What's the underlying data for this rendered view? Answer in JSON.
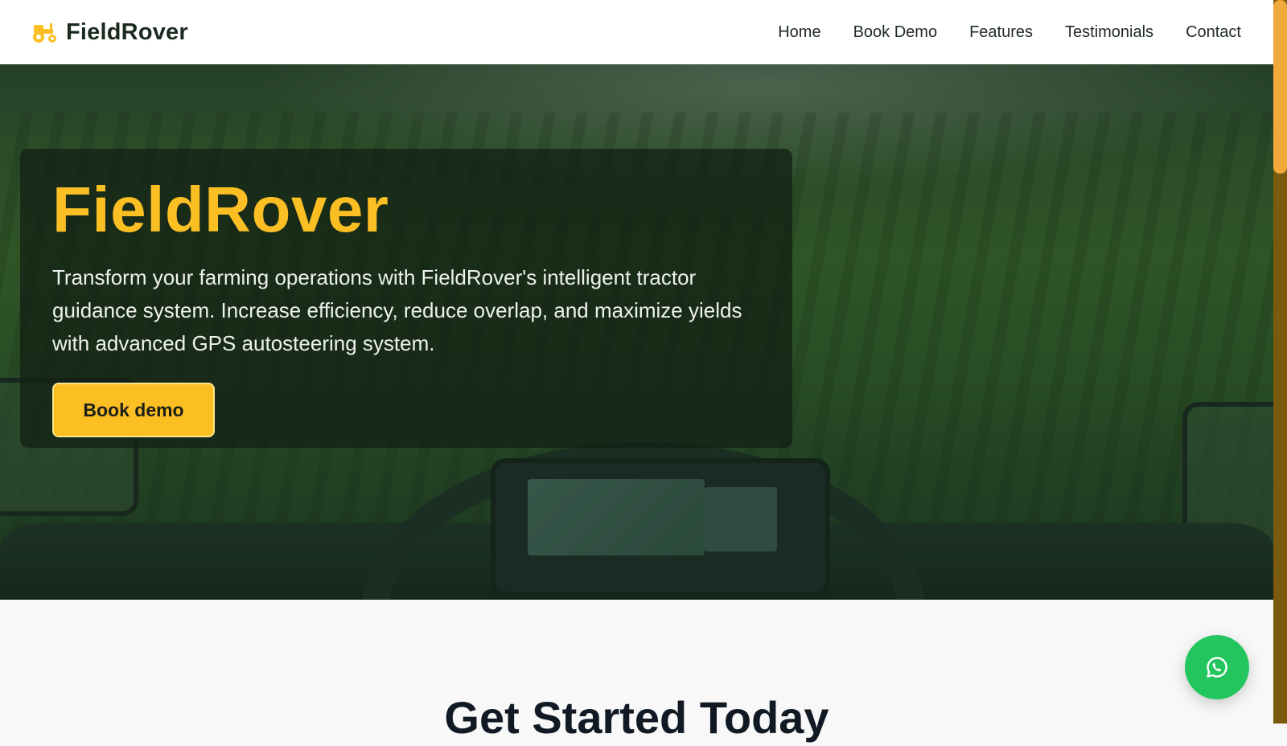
{
  "brand": {
    "name": "FieldRover",
    "icon": "tractor-icon",
    "icon_color": "#fbbf24"
  },
  "nav": {
    "items": [
      {
        "label": "Home"
      },
      {
        "label": "Book Demo"
      },
      {
        "label": "Features"
      },
      {
        "label": "Testimonials"
      },
      {
        "label": "Contact"
      }
    ]
  },
  "hero": {
    "title": "FieldRover",
    "text": "Transform your farming operations with FieldRover's intelligent tractor guidance system. Increase efficiency, reduce overlap, and maximize yields with advanced GPS autosteering system.",
    "cta_label": "Book demo",
    "background_image": "tractor-cab-field-view"
  },
  "section": {
    "title": "Get Started Today"
  },
  "floating": {
    "icon": "whatsapp-icon",
    "color": "#22c55e"
  },
  "colors": {
    "accent": "#fbbf24",
    "text_dark": "#1b2a1f",
    "whatsapp": "#22c55e"
  }
}
